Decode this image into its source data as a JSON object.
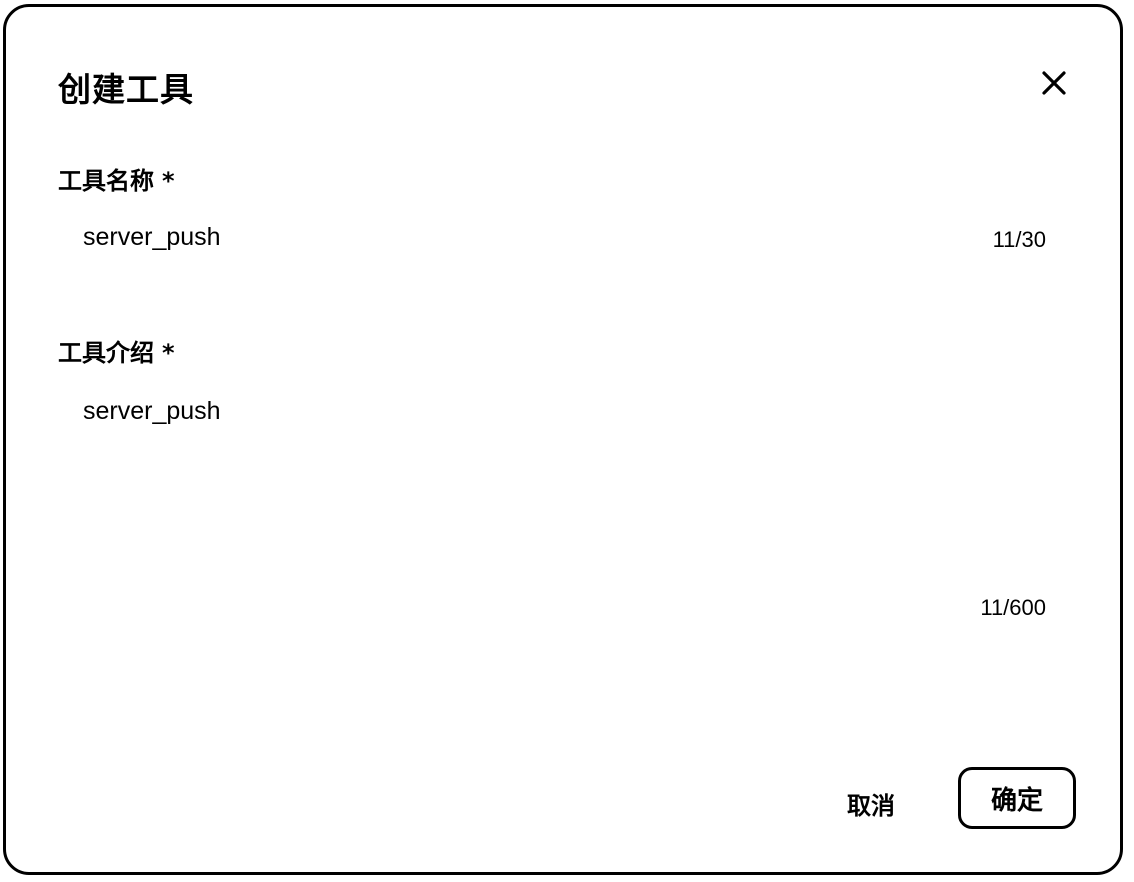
{
  "dialog": {
    "title": "创建工具",
    "close_icon": "close-icon"
  },
  "fields": {
    "name": {
      "label": "工具名称",
      "required_mark": "*",
      "value": "server_push",
      "counter": "11/30"
    },
    "description": {
      "label": "工具介绍",
      "required_mark": "*",
      "value": "server_push",
      "counter": "11/600"
    }
  },
  "footer": {
    "cancel_label": "取消",
    "confirm_label": "确定"
  }
}
